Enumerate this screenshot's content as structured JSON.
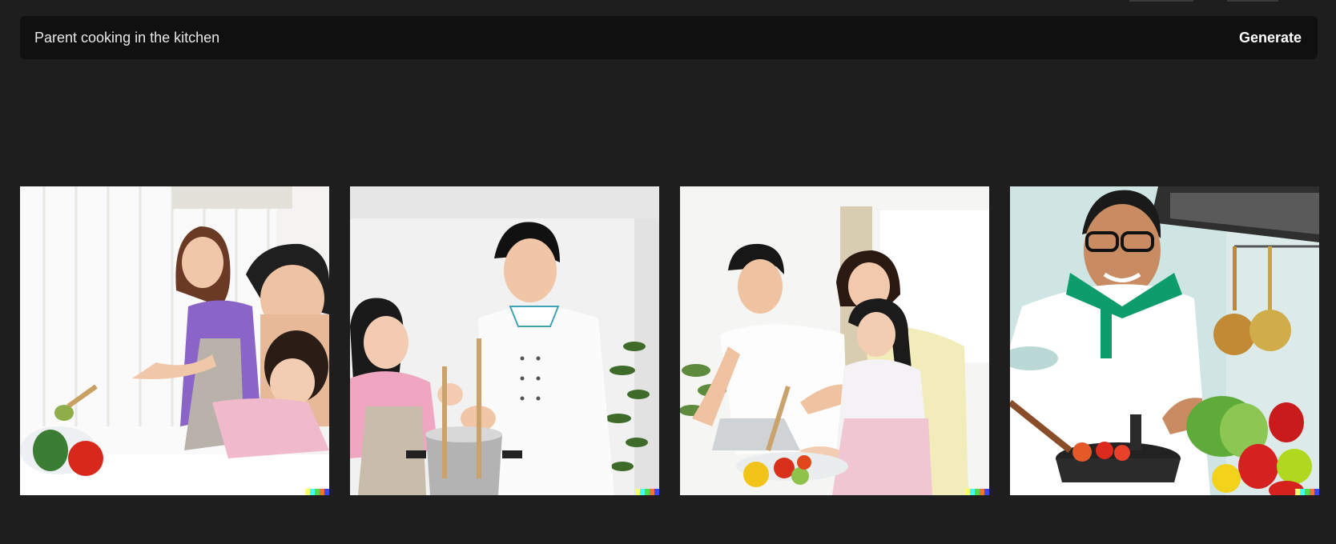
{
  "prompt": {
    "value": "Parent cooking in the kitchen",
    "generate_label": "Generate"
  },
  "results": [
    {
      "name": "result-image-1"
    },
    {
      "name": "result-image-2"
    },
    {
      "name": "result-image-3"
    },
    {
      "name": "result-image-4"
    }
  ],
  "watermark_colors": [
    "#ffff66",
    "#42ffff",
    "#51da4c",
    "#ff6e3c",
    "#3c46ff"
  ],
  "colors": {
    "background": "#1e1e1e",
    "prompt_bar": "#101010",
    "text": "#ffffff"
  }
}
